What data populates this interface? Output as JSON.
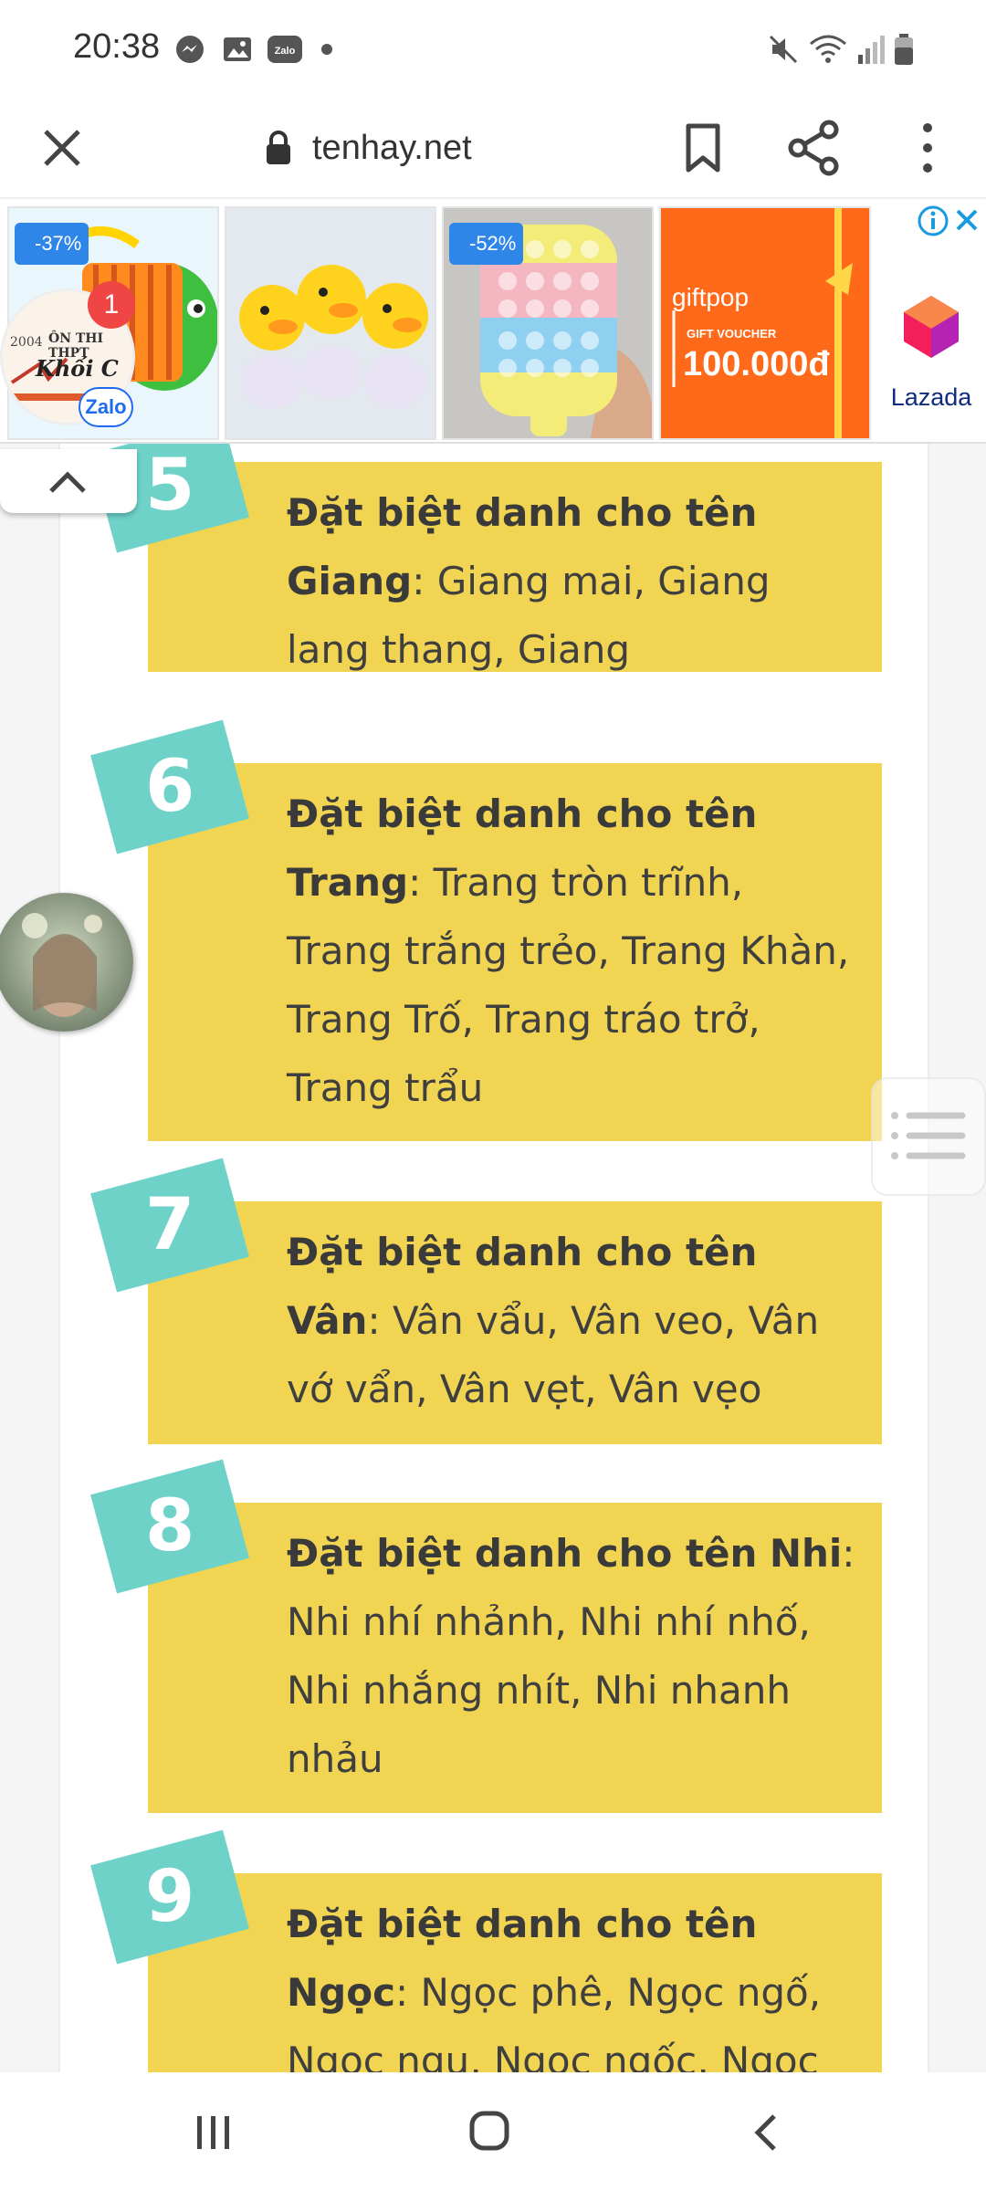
{
  "status_bar": {
    "time": "20:38",
    "icons_left": [
      "messenger-icon",
      "gallery-icon",
      "zalo-icon"
    ],
    "icons_right": [
      "mute-icon",
      "wifi-icon",
      "signal-icon",
      "battery-icon"
    ]
  },
  "browser": {
    "url": "tenhay.net"
  },
  "ads": {
    "items": [
      {
        "discount": "-37%",
        "subject": "toy accordion"
      },
      {
        "discount": "",
        "subject": "duck toys"
      },
      {
        "discount": "-52%",
        "subject": "pop it toy"
      },
      {
        "brand": "giftpop",
        "voucher_label": "GIFT VOUCHER",
        "amount": "100.000đ"
      }
    ],
    "sponsor": "Lazada"
  },
  "zalo_widget": {
    "notification_count": "1",
    "logo_text": "Zalo",
    "bubble_text_1": "2004",
    "bubble_text_2": "ÔN THI THPT",
    "bubble_text_3": "Khối C"
  },
  "article": {
    "cards": [
      {
        "number": "5",
        "label": "Đặt biệt danh cho tên",
        "name": "Giang",
        "names_text": ": Giang mai, Giang lang thang, Giang"
      },
      {
        "number": "6",
        "label": "Đặt biệt danh cho tên",
        "name": "Trang",
        "names_text": ": Trang tròn trĩnh, Trang trắng trẻo, Trang Khàn, Trang Trố, Trang tráo trở, Trang trẩu"
      },
      {
        "number": "7",
        "label": "Đặt biệt danh cho tên",
        "name": "Vân",
        "names_text": ": Vân vẩu, Vân veo, Vân vớ vẩn, Vân vẹt, Vân vẹo"
      },
      {
        "number": "8",
        "label": "Đặt biệt danh cho tên",
        "name": "Nhi",
        "names_text": ": Nhi nhí nhảnh, Nhi nhí nhố, Nhi nhắng nhít, Nhi nhanh nhảu"
      },
      {
        "number": "9",
        "label": "Đặt biệt danh cho tên",
        "name": "Ngọc",
        "names_text": ": Ngọc phê, Ngọc ngố, Ngọc ngu, Ngọc ngốc, Ngọc"
      }
    ]
  },
  "colors": {
    "card_bg": "#f0d452",
    "badge_bg": "#6fd2c9",
    "text": "#3f3f3f",
    "giftpop_orange": "#ff6a1a"
  }
}
